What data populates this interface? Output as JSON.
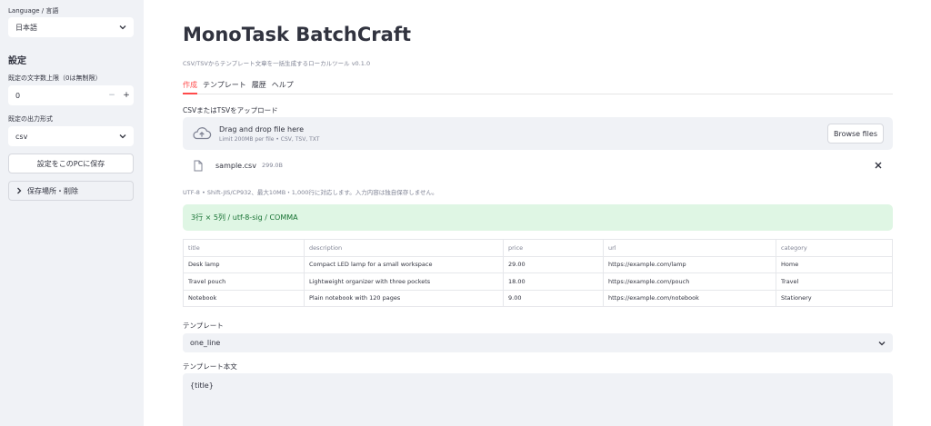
{
  "sidebar": {
    "language_label": "Language / 言語",
    "language_value": "日本語",
    "settings_heading": "設定",
    "char_limit_label": "既定の文字数上限（0は無制限）",
    "char_limit_value": "0",
    "stepper_minus": "−",
    "stepper_plus": "+",
    "output_format_label": "既定の出力形式",
    "output_format_value": "csv",
    "save_button": "設定をこのPCに保存",
    "expander_label": "保存場所・削除"
  },
  "main": {
    "title": "MonoTask BatchCraft",
    "subtitle": "CSV/TSVからテンプレート文章を一括生成するローカルツール v0.1.0",
    "tabs": [
      {
        "label": "作成",
        "active": true
      },
      {
        "label": "テンプレート",
        "active": false
      },
      {
        "label": "履歴",
        "active": false
      },
      {
        "label": "ヘルプ",
        "active": false
      }
    ],
    "upload_label": "CSVまたはTSVをアップロード",
    "dropzone": {
      "main_text": "Drag and drop file here",
      "sub_text": "Limit 200MB per file • CSV, TSV, TXT",
      "browse_label": "Browse files"
    },
    "file": {
      "name": "sample.csv",
      "size": "299.0B"
    },
    "caption": "UTF-8 • Shift-JIS/CP932、最大10MB・1,000行に対応します。入力内容は独自保存しません。",
    "success_message": "3行 × 5列 / utf-8-sig / COMMA",
    "table": {
      "columns": [
        "title",
        "description",
        "price",
        "url",
        "category"
      ],
      "rows": [
        [
          "Desk lamp",
          "Compact LED lamp for a small workspace",
          "29.00",
          "https://example.com/lamp",
          "Home"
        ],
        [
          "Travel pouch",
          "Lightweight organizer with three pockets",
          "18.00",
          "https://example.com/pouch",
          "Travel"
        ],
        [
          "Notebook",
          "Plain notebook with 120 pages",
          "9.00",
          "https://example.com/notebook",
          "Stationery"
        ]
      ]
    },
    "template_label": "テンプレート",
    "template_value": "one_line",
    "template_body_label": "テンプレート本文",
    "template_body_value": "{title}"
  },
  "colors": {
    "accent": "#ff4b4b",
    "sidebar_bg": "#f0f2f6",
    "success_bg": "#dff6e4",
    "success_text": "#177233"
  },
  "icons": {
    "upload": "cloud-upload-icon",
    "file": "file-icon",
    "close": "close-icon",
    "chevron": "chevron-down-icon",
    "expander": "chevron-right-icon"
  }
}
